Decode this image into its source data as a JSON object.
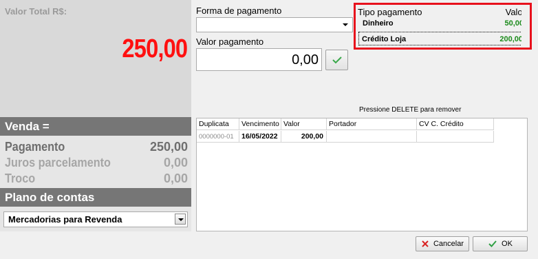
{
  "total": {
    "label": "Valor Total R$:",
    "value": "250,00"
  },
  "venda": {
    "title": "Venda =",
    "rows": [
      {
        "label": "Pagamento",
        "value": "250,00"
      },
      {
        "label": "Juros parcelamento",
        "value": "0,00"
      },
      {
        "label": "Troco",
        "value": "0,00"
      }
    ]
  },
  "plano": {
    "title": "Plano de contas",
    "selected": "Mercadorias para Revenda"
  },
  "forma": {
    "label": "Forma de pagamento",
    "selected": ""
  },
  "valor_pagamento": {
    "label": "Valor pagamento",
    "value": "0,00"
  },
  "payment_types": {
    "header_type": "Tipo pagamento",
    "header_value": "Valor",
    "rows": [
      {
        "name": "Dinheiro",
        "value": "50,00"
      },
      {
        "name": "Crédito Loja",
        "value": "200,00"
      }
    ]
  },
  "table": {
    "hint": "Pressione DELETE para remover",
    "columns": [
      "Duplicata",
      "Vencimento",
      "Valor",
      "Portador",
      "CV C. Crédito"
    ],
    "rows": [
      [
        "0000000-01",
        "16/05/2022",
        "200,00",
        "",
        ""
      ]
    ]
  },
  "buttons": {
    "cancel": "Cancelar",
    "ok": "OK"
  },
  "colors": {
    "total_red": "#ff1010",
    "value_green": "#1a8a1a",
    "highlight_border": "#e8101c"
  },
  "icons": {
    "confirm": "check-icon",
    "cancel": "x-icon",
    "ok": "check-icon"
  }
}
